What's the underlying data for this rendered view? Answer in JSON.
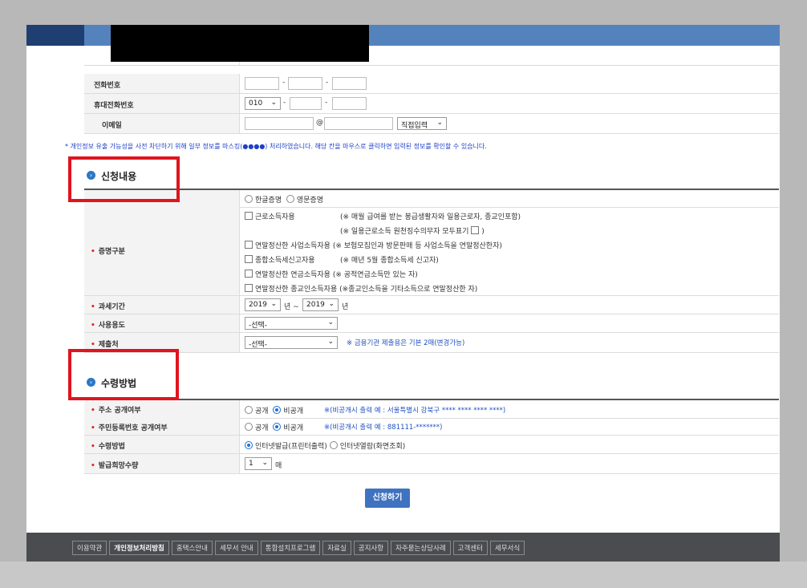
{
  "contact": {
    "phone_label": "전화번호",
    "mobile_label": "휴대전화번호",
    "mobile_prefix": "010",
    "email_label": "이메일",
    "email_at": "@",
    "email_domain_select": "직접입력",
    "dash": "-"
  },
  "privacy_notice": {
    "prefix": "* 개인정보 유출 가능성을 사전 차단하기 위해 일부 정보를 마스킹(",
    "dots": "●●●●",
    "suffix": ") 처리하였습니다. 해당 칸을 마우스로 클릭하면 입력된 정보를 확인할 수 있습니다."
  },
  "section_request": {
    "title": "신청내용",
    "lang_options": [
      "한글증명",
      "영문증명"
    ],
    "cert_type_label": "증명구분",
    "cert_options": [
      {
        "label": "근로소득자용",
        "note": "(※ 매월 급여를 받는 봉급생활자와 일용근로자, 종교인포함)"
      },
      {
        "label": "",
        "note": "(※ 일용근로소득 원천징수의무자 모두표기"
      },
      {
        "label": "연말정산한 사업소득자용",
        "note": "(※ 보험모집인과 방문판매 등 사업소득을 연말정산한자)"
      },
      {
        "label": "종합소득세신고자용",
        "note": "(※ 매년 5월 종합소득세 신고자)"
      },
      {
        "label": "연말정산한 연금소득자용",
        "note": "(※ 공적연금소득만 있는 자)"
      },
      {
        "label": "연말정산한 종교인소득자용",
        "note": "(※종교인소득을 기타소득으로 연말정산한 자)"
      }
    ],
    "cert_note_close": ")",
    "tax_period_label": "과세기간",
    "tax_year_from": "2019",
    "tax_year_to": "2019",
    "year_unit": "년",
    "tilde": "~",
    "usage_label": "사용용도",
    "usage_select": "-선택-",
    "submit_to_label": "제출처",
    "submit_to_select": "-선택-",
    "submit_to_note": "※ 금융기관 제출용은 기본 2매(변경가능)"
  },
  "section_receive": {
    "title": "수령방법",
    "address_label": "주소 공개여부",
    "address_options": [
      "공개",
      "비공개"
    ],
    "address_note": "※(비공개시 출력 예 : 서울특별시 강북구 **** **** **** ****)",
    "rrn_label": "주민등록번호 공개여부",
    "rrn_options": [
      "공개",
      "비공개"
    ],
    "rrn_note": "※(비공개시 출력 예 : 881111-*******)",
    "method_label": "수령방법",
    "method_options": [
      "인터넷발급(프린터출력)",
      "인터넷열람(화면조회)"
    ],
    "qty_label": "발급희망수량",
    "qty_value": "1",
    "qty_unit": "매"
  },
  "submit_label": "신청하기",
  "footer_links": [
    "이용약관",
    "개인정보처리방침",
    "홈택스안내",
    "세무서 안내",
    "통합설치프로그램",
    "자료실",
    "공지사항",
    "자주묻는상담사례",
    "고객센터",
    "세무서식"
  ],
  "colors": {
    "accent": "#3f73c1",
    "required": "#e0232e",
    "highlight_box": "#e0141e",
    "topbar": "#5482bd",
    "footer": "#4b4c4f"
  }
}
